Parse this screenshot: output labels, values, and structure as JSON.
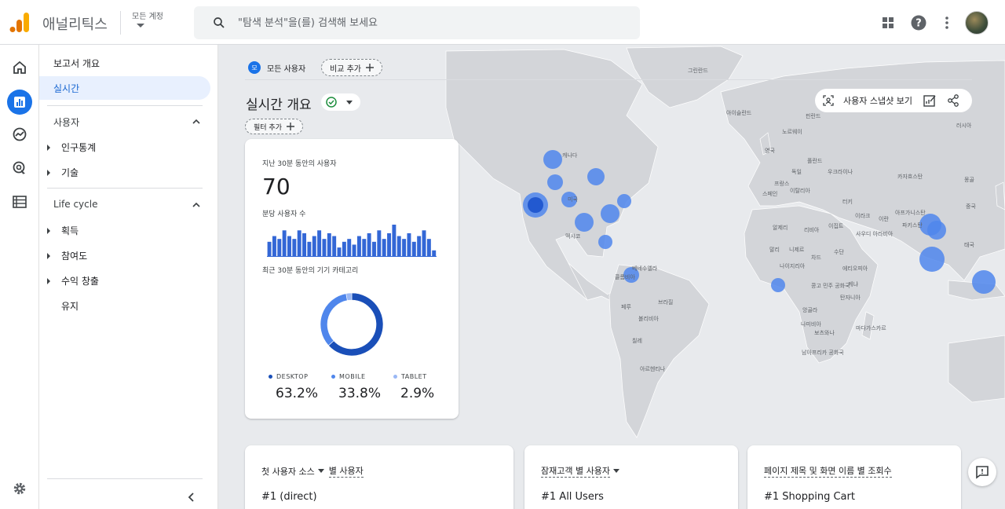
{
  "app": {
    "name": "애널리틱스",
    "account_label": "모든 계정"
  },
  "search": {
    "placeholder": "\"탐색 분석\"을(를) 검색해 보세요"
  },
  "nav": {
    "overview": "보고서 개요",
    "realtime": "실시간",
    "section_user": "사용자",
    "user_items": [
      "인구통계",
      "기술"
    ],
    "section_lifecycle": "Life cycle",
    "lifecycle_items": [
      "획득",
      "참여도",
      "수익 창출",
      "유지"
    ]
  },
  "header": {
    "all_users_badge": "모",
    "all_users": "모든 사용자",
    "add_compare": "비교 추가",
    "page_title": "실시간 개요",
    "add_filter": "필터 추가",
    "snapshot": "사용자 스냅샷 보기"
  },
  "card": {
    "users_label": "지난 30분 동안의 사용자",
    "users_value": "70",
    "per_minute_label": "분당 사용자 수",
    "per_minute": [
      5,
      7,
      6,
      9,
      7,
      6,
      9,
      8,
      5,
      7,
      9,
      6,
      8,
      7,
      3,
      5,
      6,
      4,
      7,
      6,
      8,
      5,
      9,
      6,
      8,
      11,
      7,
      6,
      8,
      5,
      7,
      9,
      6,
      2
    ],
    "device_label": "최근 30분 동안의 기기 카테고리",
    "devices": [
      {
        "name": "DESKTOP",
        "pct": "63.2%",
        "value": 63.2,
        "color": "#1a4fb8"
      },
      {
        "name": "MOBILE",
        "pct": "33.8%",
        "value": 33.8,
        "color": "#4f86ec"
      },
      {
        "name": "TABLET",
        "pct": "2.9%",
        "value": 2.9,
        "color": "#9ab8f5"
      }
    ]
  },
  "bottom_cards": [
    {
      "title_a": "첫 사용자 소스",
      "title_b": "별 사용자",
      "row": "#1  (direct)"
    },
    {
      "title_a": "잠재고객 별 사용자",
      "title_b": "",
      "row": "#1  All Users"
    },
    {
      "title_a": "페이지 제목 및 화면 이름 별 조회수",
      "title_b": "",
      "row": "#1  Shopping Cart"
    }
  ],
  "map_labels": [
    "그린란드",
    "아이슬란드",
    "노르웨이",
    "핀란드",
    "러시아",
    "영국",
    "독일",
    "폴란드",
    "우크라이나",
    "카자흐스탄",
    "몽골",
    "프랑스",
    "이탈리아",
    "스페인",
    "터키",
    "중국",
    "캐나다",
    "미국",
    "멕시코",
    "이라크",
    "이란",
    "아프가니스탄",
    "파키스탄",
    "알제리",
    "리비아",
    "이집트",
    "사우디 아라비아",
    "말리",
    "니제르",
    "차드",
    "수단",
    "나이지리아",
    "에티오피아",
    "케냐",
    "탄자니아",
    "콩고 민주 공화국",
    "앙골라",
    "나미비아",
    "보츠와나",
    "남아프리카 공화국",
    "마다가스카르",
    "태국",
    "베네수엘라",
    "콜롬비아",
    "브라질",
    "페루",
    "볼리비아",
    "칠레",
    "아르헨티나"
  ],
  "icons": [
    "analytics-logo",
    "search-icon",
    "apps-icon",
    "help-icon",
    "more-icon",
    "home-icon",
    "reports-icon",
    "explore-icon",
    "advertising-icon",
    "configure-icon",
    "settings-icon",
    "collapse-icon",
    "feedback-icon",
    "check-circle-icon",
    "snapshot-icon",
    "edit-chart-icon",
    "share-icon"
  ],
  "colors": {
    "accent": "#1a73e8",
    "bubble": "#4f86ec",
    "map_land": "#d3d5d9",
    "map_ocean": "#e8eaed"
  }
}
